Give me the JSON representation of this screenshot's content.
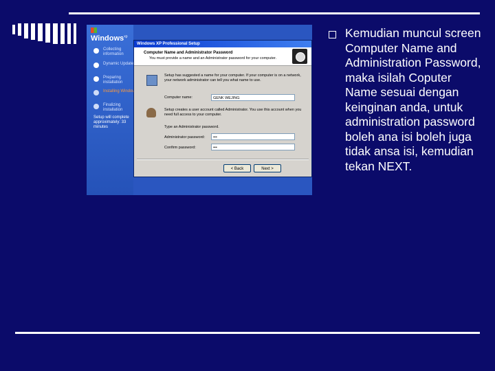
{
  "slide": {
    "bullet_text": "Kemudian muncul screen Computer Name and Administration Password, maka isilah Coputer Name sesuai dengan keinginan anda, untuk administration password boleh ana isi boleh juga tidak ansa isi, kemudian tekan NEXT."
  },
  "screenshot": {
    "logo": {
      "brand": "Windows",
      "suffix": "xp"
    },
    "steps": [
      {
        "label": "Collecting information"
      },
      {
        "label": "Dynamic Update"
      },
      {
        "label": "Preparing installation"
      },
      {
        "label": "Installing Windows"
      },
      {
        "label": "Finalizing installation"
      }
    ],
    "estimate": "Setup will complete approximately: 33 minutes",
    "dialog": {
      "title": "Windows XP Professional Setup",
      "heading": "Computer Name and Administrator Password",
      "subheading": "You must provide a name and an Administrator password for your computer.",
      "name_info": "Setup has suggested a name for your computer. If your computer is on a network, your network administrator can tell you what name to use.",
      "computer_name_label": "Computer name:",
      "computer_name_value": "GENK WEJING",
      "admin_info": "Setup creates a user account called Administrator. You use this account when you need full access to your computer.",
      "password_prompt": "Type an Administrator password.",
      "admin_password_label": "Administrator password:",
      "admin_password_value": "•••",
      "confirm_password_label": "Confirm password:",
      "confirm_password_value": "•••",
      "back_button": "< Back",
      "next_button": "Next >"
    }
  }
}
